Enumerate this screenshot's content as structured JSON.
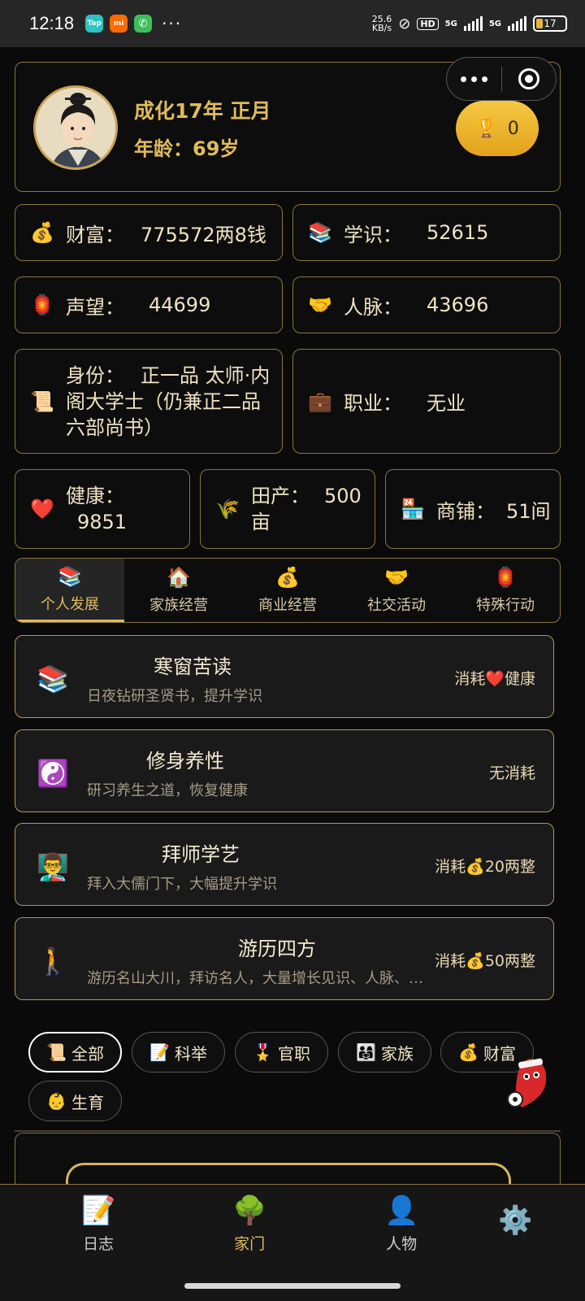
{
  "status_bar": {
    "time": "12:18",
    "apps": [
      "Tap",
      "mi",
      "phone"
    ],
    "more": "···",
    "net_speed": "25.6",
    "net_unit": "KB/s",
    "hd": "HD",
    "net1": "5G",
    "net2": "5G",
    "battery": "17"
  },
  "profile": {
    "date": "成化17年 正月",
    "age": "年龄：69岁",
    "trophy_count": "0"
  },
  "stats": {
    "wealth": {
      "icon": "💰",
      "label": "财富：",
      "value": "775572两8钱"
    },
    "knowledge": {
      "icon": "📚",
      "label": "学识：",
      "value": "52615"
    },
    "prestige": {
      "icon": "🏮",
      "label": "声望：",
      "value": "44699"
    },
    "connections": {
      "icon": "🤝",
      "label": "人脉：",
      "value": "43696"
    },
    "identity": {
      "icon": "📜",
      "label": "身份：",
      "value_1": "正一品 太师·内",
      "value_2": "阁大学士（仍兼正二品",
      "value_3": "六部尚书）"
    },
    "occupation": {
      "icon": "💼",
      "label": "职业：",
      "value": "无业"
    },
    "health": {
      "icon": "❤️",
      "label": "健康：",
      "value": "9851"
    },
    "farmland": {
      "icon": "🌾",
      "label": "田产：",
      "value": "500",
      "unit": "亩"
    },
    "shops": {
      "icon": "🏪",
      "label": "商铺：",
      "value": "51间"
    }
  },
  "tabs": [
    {
      "icon": "📚",
      "label": "个人发展"
    },
    {
      "icon": "🏠",
      "label": "家族经营"
    },
    {
      "icon": "💰",
      "label": "商业经营"
    },
    {
      "icon": "🤝",
      "label": "社交活动"
    },
    {
      "icon": "🏮",
      "label": "特殊行动"
    }
  ],
  "actions": [
    {
      "icon": "📚",
      "title": "寒窗苦读",
      "desc": "日夜钻研圣贤书，提升学识",
      "cost": "消耗❤️健康"
    },
    {
      "icon": "☯️",
      "title": "修身养性",
      "desc": "研习养生之道，恢复健康",
      "cost": "无消耗"
    },
    {
      "icon": "👨‍🏫",
      "title": "拜师学艺",
      "desc": "拜入大儒门下，大幅提升学识",
      "cost": "消耗💰20两整"
    },
    {
      "icon": "🚶",
      "title": "游历四方",
      "desc": "游历名山大川，拜访名人，大量增长见识、人脉、…",
      "cost": "消耗💰50两整"
    }
  ],
  "filters": [
    {
      "icon": "📜",
      "label": "全部"
    },
    {
      "icon": "📝",
      "label": "科举"
    },
    {
      "icon": "🎖️",
      "label": "官职"
    },
    {
      "icon": "👨‍👩‍👧",
      "label": "家族"
    },
    {
      "icon": "💰",
      "label": "财富"
    },
    {
      "icon": "👶",
      "label": "生育"
    }
  ],
  "bottom_nav": [
    {
      "icon": "📝",
      "label": "日志"
    },
    {
      "icon": "🌳",
      "label": "家门"
    },
    {
      "icon": "👤",
      "label": "人物"
    },
    {
      "icon": "⚙️",
      "label": ""
    }
  ],
  "colors": {
    "accent_gold": "#e0bb5c",
    "border_gold": "#8a7440",
    "trophy": "#f2b92e"
  }
}
